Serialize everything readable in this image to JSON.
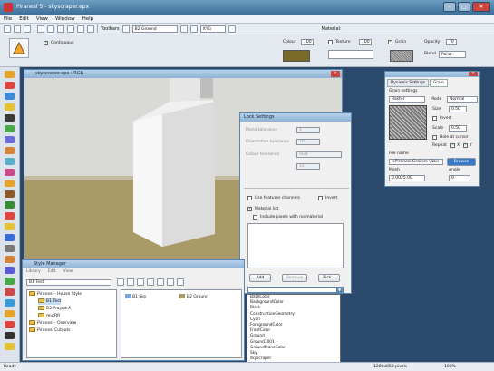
{
  "app": {
    "title": "Piranesi 5 - skyscraper.epx"
  },
  "menu": [
    "File",
    "Edit",
    "View",
    "Window",
    "Help"
  ],
  "toolbar": {
    "toolbars_label": "Toolbars",
    "layer_select": "B2 Ground",
    "units_select": "XYG",
    "material_label": "Material:"
  },
  "options": {
    "contiguous_label": "Contiguous",
    "colour_label": "Colour",
    "colour_value": "100",
    "texture_label": "Texture",
    "texture_value": "100",
    "grain_label": "Grain",
    "opacity_label": "Opacity",
    "opacity_value": "70",
    "blend_label": "Blend",
    "blend_value": "Paint",
    "colour_swatch": "#7a6a2a"
  },
  "viewport": {
    "title": "skyscraper.epx : RGB"
  },
  "lock_settings": {
    "title": "Lock Settings",
    "plane_tolerance_label": "Plane tolerance",
    "plane_tolerance_value": "1",
    "orientation_tolerance_label": "Orientation tolerance",
    "orientation_tolerance_value": "10",
    "colour_tolerance_label": "Colour tolerance",
    "colour_tolerance_value": "RGB",
    "extra_value": "15",
    "use_feature_channels": "Use features channels",
    "invert": "Invert",
    "material_list": "Material list",
    "include_pixels": "Include pixels with no material",
    "add_button": "Add",
    "remove_button": "Remove",
    "pick_button": "Pick..."
  },
  "materials_dropdown": [
    "BackColor",
    "BackgroundColor",
    "Black",
    "ConstructionGeometry",
    "Cyan",
    "ForegroundColor",
    "FrontColor",
    "Ground",
    "Ground1001",
    "GroundPlaneColor",
    "Sky",
    "skyscraper"
  ],
  "grain_panel": {
    "tab_dynamic": "Dynamic Settings",
    "tab_grain": "Grain",
    "settings_label": "Grain settings",
    "type_value": "Raster",
    "mode_label": "Mode",
    "mode_value": "Normal",
    "size_label": "Size",
    "size_value": "0.50",
    "invert_label": "Invert",
    "scale_label": "Scale",
    "scale_value": "0.50",
    "hole_label": "Hole at cursor",
    "repeat_label": "Repeat",
    "repeat_x": "X",
    "repeat_y": "Y",
    "file_name_label": "File name",
    "file_name_value": "<Piranesi Grains>\\Nois",
    "browse_label": "Browse",
    "mesh_label": "Mesh",
    "mesh_value": "0.0025.00",
    "angle_label": "Angle",
    "angle_value": "0"
  },
  "style_manager": {
    "title": "Style Manager",
    "menu": [
      "Library",
      "Edit",
      "View"
    ],
    "search_value": "B1 Test",
    "tree": [
      "Piranesi - House Style",
      "B1 Test",
      "B2 Project A",
      "mutRR",
      "Piranesi - Overview",
      "Piranesi Cutouts"
    ],
    "layers": [
      "B1 Sky",
      "B2 Ground"
    ]
  },
  "status": {
    "left": "Ready",
    "size": "1280x853 pixels",
    "zoom": "100%"
  }
}
